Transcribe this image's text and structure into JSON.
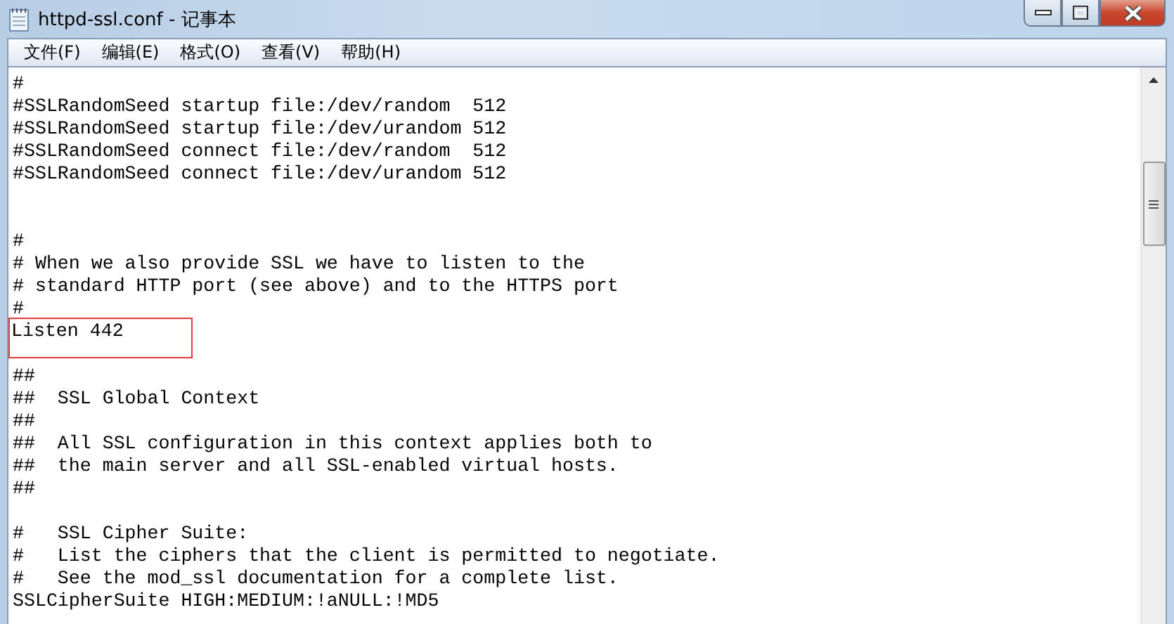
{
  "window": {
    "title": "httpd-ssl.conf - 记事本"
  },
  "menu": [
    "文件(F)",
    "编辑(E)",
    "格式(O)",
    "查看(V)",
    "帮助(H)"
  ],
  "lines": [
    {
      "kind": "text",
      "text": "#",
      "highlighted": false
    },
    {
      "kind": "text",
      "text": "#SSLRandomSeed startup file:/dev/random  512",
      "highlighted": false
    },
    {
      "kind": "text",
      "text": "#SSLRandomSeed startup file:/dev/urandom 512",
      "highlighted": false
    },
    {
      "kind": "text",
      "text": "#SSLRandomSeed connect file:/dev/random  512",
      "highlighted": false
    },
    {
      "kind": "text",
      "text": "#SSLRandomSeed connect file:/dev/urandom 512",
      "highlighted": false
    },
    {
      "kind": "blank"
    },
    {
      "kind": "blank"
    },
    {
      "kind": "text",
      "text": "#",
      "highlighted": false
    },
    {
      "kind": "text",
      "text": "# When we also provide SSL we have to listen to the",
      "highlighted": false
    },
    {
      "kind": "text",
      "text": "# standard HTTP port (see above) and to the HTTPS port",
      "highlighted": false
    },
    {
      "kind": "text",
      "text": "#",
      "highlighted": false
    },
    {
      "kind": "text",
      "text": "Listen 442",
      "highlighted": true
    },
    {
      "kind": "blank"
    },
    {
      "kind": "text",
      "text": "##",
      "highlighted": false
    },
    {
      "kind": "text",
      "text": "##  SSL Global Context",
      "highlighted": false
    },
    {
      "kind": "text",
      "text": "##",
      "highlighted": false
    },
    {
      "kind": "text",
      "text": "##  All SSL configuration in this context applies both to",
      "highlighted": false
    },
    {
      "kind": "text",
      "text": "##  the main server and all SSL-enabled virtual hosts.",
      "highlighted": false
    },
    {
      "kind": "text",
      "text": "##",
      "highlighted": false
    },
    {
      "kind": "blank"
    },
    {
      "kind": "text",
      "text": "#   SSL Cipher Suite:",
      "highlighted": false
    },
    {
      "kind": "text",
      "text": "#   List the ciphers that the client is permitted to negotiate.",
      "highlighted": false
    },
    {
      "kind": "text",
      "text": "#   See the mod_ssl documentation for a complete list.",
      "highlighted": false
    },
    {
      "kind": "text",
      "text": "SSLCipherSuite HIGH:MEDIUM:!aNULL:!MD5",
      "highlighted": false
    }
  ]
}
